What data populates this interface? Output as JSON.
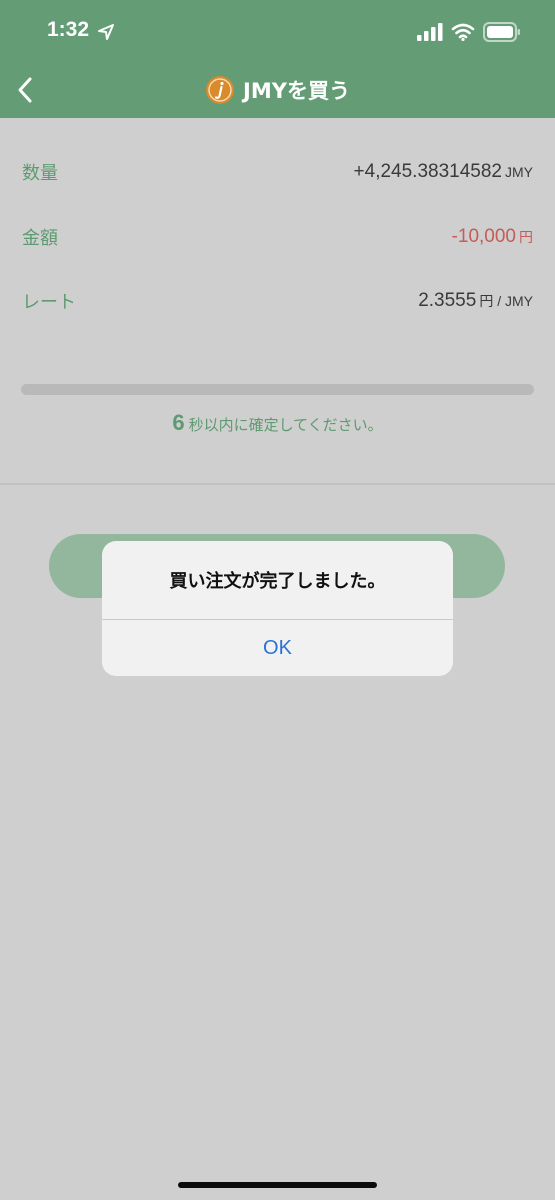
{
  "status_bar": {
    "time": "1:32",
    "icons": [
      "location-arrow-icon",
      "cellular-signal-icon",
      "wifi-icon",
      "battery-icon"
    ]
  },
  "nav": {
    "back_icon": "chevron-left-icon",
    "coin_icon": "jmy-coin-icon",
    "title": "JMYを買う"
  },
  "details": {
    "quantity": {
      "label": "数量",
      "value": "+4,245.38314582",
      "unit": "JMY"
    },
    "amount": {
      "label": "金額",
      "value": "-10,000",
      "unit": "円"
    },
    "rate": {
      "label": "レート",
      "value": "2.3555",
      "unit": "円 / JMY"
    }
  },
  "countdown": {
    "seconds": "6",
    "text": "秒以内に確定してください。"
  },
  "alert": {
    "message": "買い注文が完了しました。",
    "ok_label": "OK"
  },
  "colors": {
    "header": "#649d75",
    "label_green": "#5e9a71",
    "negative_red": "#c45c57",
    "alert_button_blue": "#2a73d4",
    "coin_orange": "#d98a2b"
  }
}
